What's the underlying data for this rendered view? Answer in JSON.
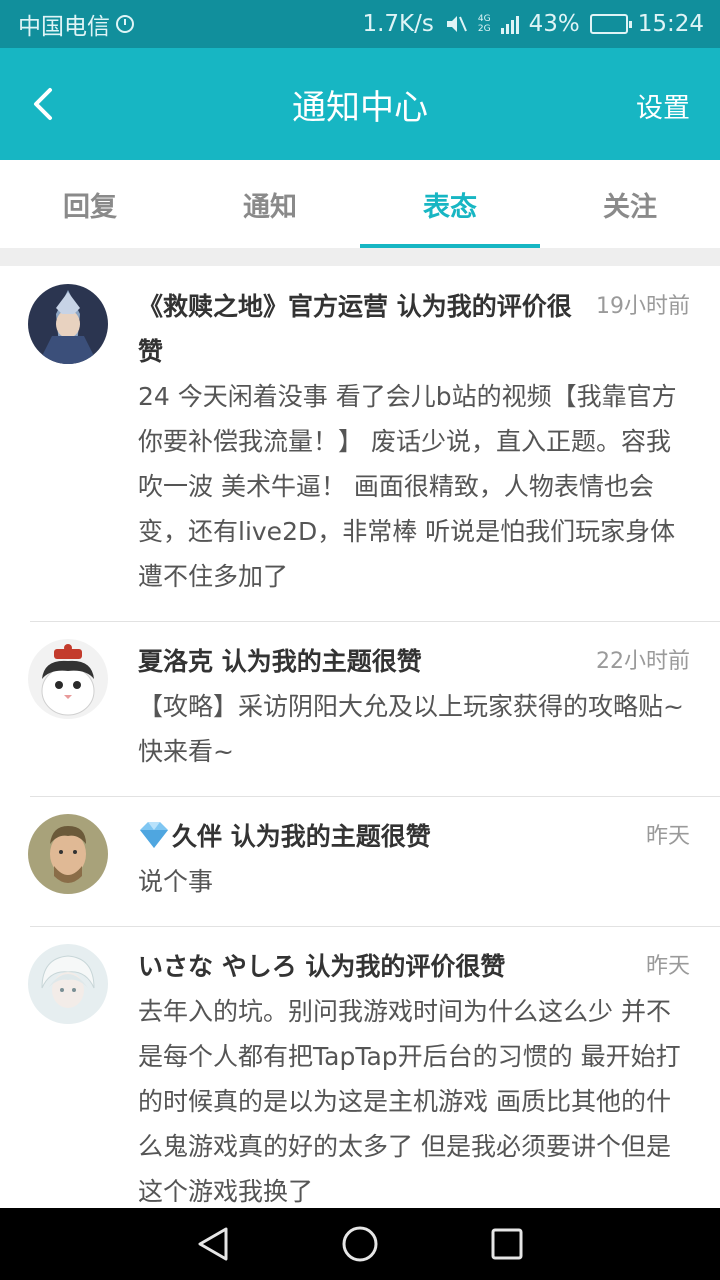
{
  "status_bar": {
    "carrier": "中国电信",
    "speed": "1.7K/s",
    "network": [
      "4G",
      "2G"
    ],
    "battery": "43%",
    "battery_level": 0.43,
    "time": "15:24"
  },
  "header": {
    "title": "通知中心",
    "settings_label": "设置",
    "accent_color": "#17b6c3"
  },
  "tabs": [
    {
      "label": "回复",
      "active": false
    },
    {
      "label": "通知",
      "active": false
    },
    {
      "label": "表态",
      "active": true
    },
    {
      "label": "关注",
      "active": false
    }
  ],
  "notifications": [
    {
      "title": "《救赎之地》官方运营 认为我的评价很赞",
      "time": "19小时前",
      "body": "24 今天闲着没事 看了会儿b站的视频【我靠官方你要补偿我流量！】 废话少说，直入正题。容我吹一波 美术牛逼！ 画面很精致，人物表情也会变，还有live2D，非常棒 听说是怕我们玩家身体遭不住多加了",
      "avatar": "knight-avatar"
    },
    {
      "title": "夏洛克 认为我的主题很赞",
      "time": "22小时前",
      "body": "【攻略】采访阴阳大允及以上玩家获得的攻略贴~快来看~",
      "avatar": "cat-avatar"
    },
    {
      "title": "久伴 认为我的主题很赞",
      "time": "昨天",
      "body": "说个事",
      "avatar": "man-avatar",
      "badge_icon": "diamond-icon"
    },
    {
      "title": "いさな やしろ 认为我的评价很赞",
      "time": "昨天",
      "body": "去年入的坑。别问我游戏时间为什么这么少 并不是每个人都有把TapTap开后台的习惯的 最开始打的时候真的是以为这是主机游戏 画质比其他的什么鬼游戏真的好的太多了 但是我必须要讲个但是 这个游戏我换了",
      "avatar": "anime-avatar"
    }
  ],
  "nav_bar": {
    "icons": [
      "back-triangle-icon",
      "home-circle-icon",
      "recent-square-icon"
    ]
  }
}
